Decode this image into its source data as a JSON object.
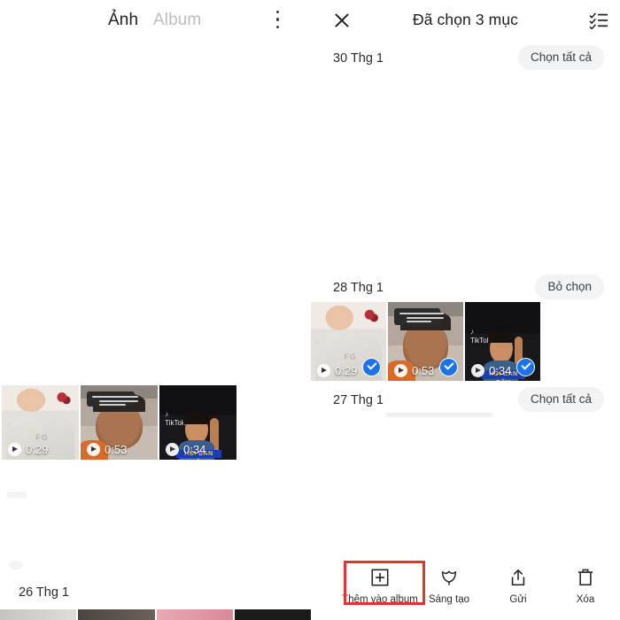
{
  "left_panel": {
    "tabs": [
      {
        "label": "Ảnh",
        "active": true
      },
      {
        "label": "Album",
        "active": false
      }
    ],
    "overflow_menu_icon": "more-vertical-icon",
    "date_header": "26 Thg 1",
    "thumbnails": [
      {
        "duration": "0:29",
        "type": "video",
        "selected": false,
        "overlay_text": "FG"
      },
      {
        "duration": "0:53",
        "type": "video",
        "selected": false,
        "overlay_text": ""
      },
      {
        "duration": "0:34",
        "type": "video",
        "selected": false,
        "overlay_text": "HỒI BAN ĐẦU"
      }
    ]
  },
  "right_panel": {
    "close_icon": "close-icon",
    "title": "Đã chọn 3 mục",
    "checklist_icon": "checklist-icon",
    "date_sections": [
      {
        "date": "30 Thg 1",
        "action": "Chọn tất cả"
      },
      {
        "date": "28 Thg 1",
        "action": "Bỏ chọn"
      },
      {
        "date": "27 Thg 1",
        "action": "Chọn tất cả"
      }
    ],
    "thumbnails": [
      {
        "duration": "0:29",
        "type": "video",
        "selected": true,
        "overlay_text": "FG"
      },
      {
        "duration": "0:53",
        "type": "video",
        "selected": true,
        "overlay_text": ""
      },
      {
        "duration": "0:34",
        "type": "video",
        "selected": true,
        "overlay_text": "HỒI BAN ĐẦU"
      }
    ],
    "toolbar": {
      "items": [
        {
          "label": "Thêm vào album",
          "icon": "add-box-icon",
          "highlighted": true
        },
        {
          "label": "Sáng tạo",
          "icon": "tulip-icon",
          "highlighted": false
        },
        {
          "label": "Gửi",
          "icon": "share-icon",
          "highlighted": false
        },
        {
          "label": "Xóa",
          "icon": "trash-icon",
          "highlighted": false
        }
      ]
    }
  },
  "colors": {
    "selection_blue": "#1a73e8",
    "highlight_red": "#e5342f",
    "pill_background": "#f1f3f4",
    "active_tab": "#1f1f1f",
    "inactive_tab": "#bdbdbd"
  }
}
